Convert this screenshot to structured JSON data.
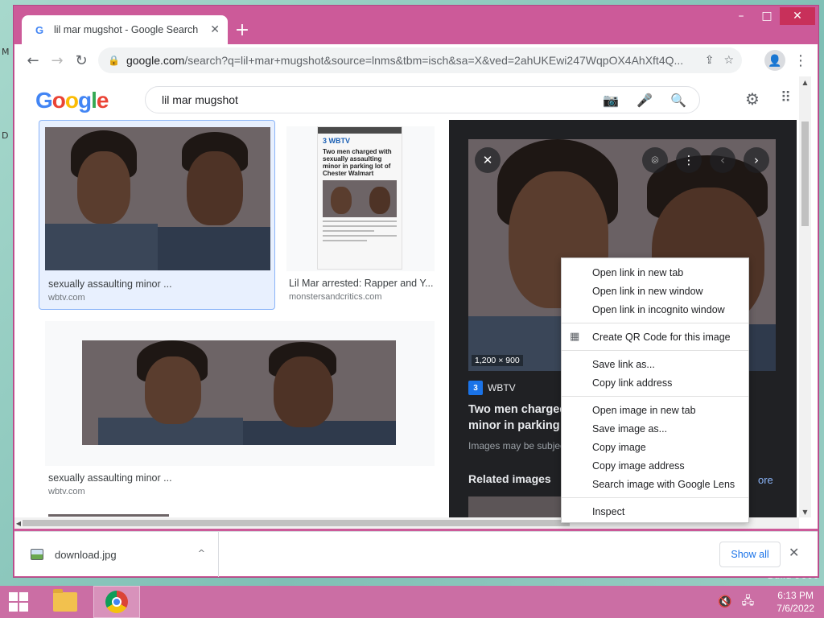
{
  "desktop": {
    "left_chars": [
      "M",
      "D"
    ],
    "build_text": "Build 9600"
  },
  "window_controls": {
    "minimize": "–",
    "maximize": "□",
    "close": "✕"
  },
  "tab": {
    "title": "lil mar mugshot - Google Search",
    "favicon": "G",
    "close": "✕",
    "new_tab": "+"
  },
  "toolbar": {
    "back": "←",
    "forward": "→",
    "reload": "↻",
    "lock": "🔒",
    "url_host": "google.com",
    "url_rest": "/search?q=lil+mar+mugshot&source=lnms&tbm=isch&sa=X&ved=2ahUKEwi247WqpOX4AhXft4Q...",
    "share": "⇪",
    "bookmark": "☆",
    "profile": "👤",
    "menu": "⋮"
  },
  "google": {
    "logo_letters": [
      "G",
      "o",
      "o",
      "g",
      "l",
      "e"
    ],
    "query": "lil mar mugshot",
    "camera_icon": "📷",
    "mic_icon": "🎤",
    "search_icon": "🔍",
    "settings_icon": "⚙",
    "apps_icon": "⠿"
  },
  "results": [
    {
      "title": "sexually assaulting minor ...",
      "site": "wbtv.com"
    },
    {
      "title": "Lil Mar arrested: Rapper and Y...",
      "site": "monstersandcritics.com"
    },
    {
      "title": "sexually assaulting minor ...",
      "site": "wbtv.com"
    }
  ],
  "article_thumb": {
    "logo": "3 WBTV",
    "headline": "Two men charged with sexually assaulting minor in parking lot of Chester Walmart"
  },
  "side_panel": {
    "close": "✕",
    "lens": "⌾",
    "more": "⋮",
    "prev": "‹",
    "next": "›",
    "dimensions": "1,200 × 900",
    "source_icon": "3",
    "source": "WBTV",
    "title_line1": "Two men charged w",
    "title_line2": "minor in parking lot",
    "copyright": "Images may be subject",
    "related": "Related images",
    "more_link": "ore"
  },
  "context_menu": {
    "group1": [
      "Open link in new tab",
      "Open link in new window",
      "Open link in incognito window"
    ],
    "qr": "Create QR Code for this image",
    "qr_icon": "▦",
    "group2": [
      "Save link as...",
      "Copy link address"
    ],
    "group3": [
      "Open image in new tab",
      "Save image as...",
      "Copy image",
      "Copy image address",
      "Search image with Google Lens"
    ],
    "inspect": "Inspect"
  },
  "download_shelf": {
    "file_name": "download.jpg",
    "chevron": "^",
    "show_all": "Show all",
    "close": "✕"
  },
  "taskbar": {
    "speaker": "🔇",
    "network": "🖧",
    "time": "6:13 PM",
    "date": "7/6/2022"
  },
  "colors": {
    "frame": "#cc5a99",
    "taskbar": "#cb6ea4",
    "accent": "#1a73e8"
  }
}
